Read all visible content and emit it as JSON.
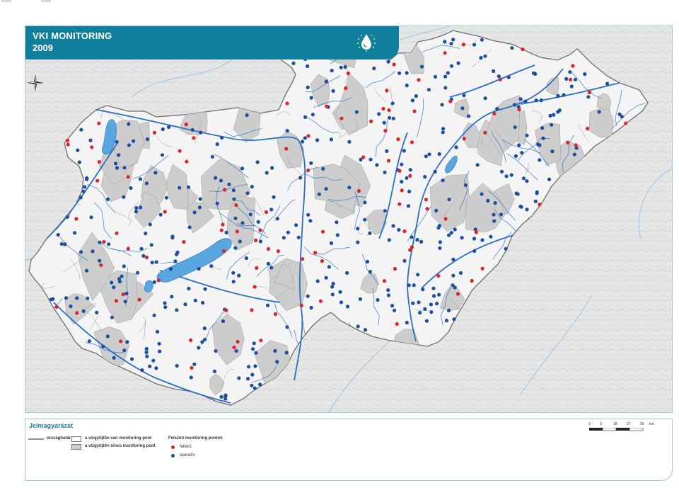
{
  "title": {
    "line1": "VKI MONITORING",
    "line2": "2009"
  },
  "legend": {
    "heading": "Jelmagyarázat",
    "border_label": "országhatár",
    "has_point_label": "a vízgyűjtőn van monitoring pont",
    "no_point_label": "a vízgyűjtőn nincs monitoring pont",
    "points_heading": "Felszíni monitoring pontok",
    "exploratory_label": "feltáró",
    "operative_label": "operatív"
  },
  "scale": {
    "ticks": [
      "0",
      "9",
      "18",
      "27",
      "36"
    ],
    "unit": "km"
  },
  "colors": {
    "exploratory": "#d7262c",
    "operative": "#1d4f9c",
    "river": "#2c6fc1",
    "lake": "#5aa6e0",
    "country_fill": "#f4f4f4",
    "grey_basin": "#cdcdcd",
    "title_bg": "#0f7f9d"
  },
  "icons": {
    "north_arrow": "compass-rose-icon",
    "logo": "water-drop-logo-icon"
  }
}
